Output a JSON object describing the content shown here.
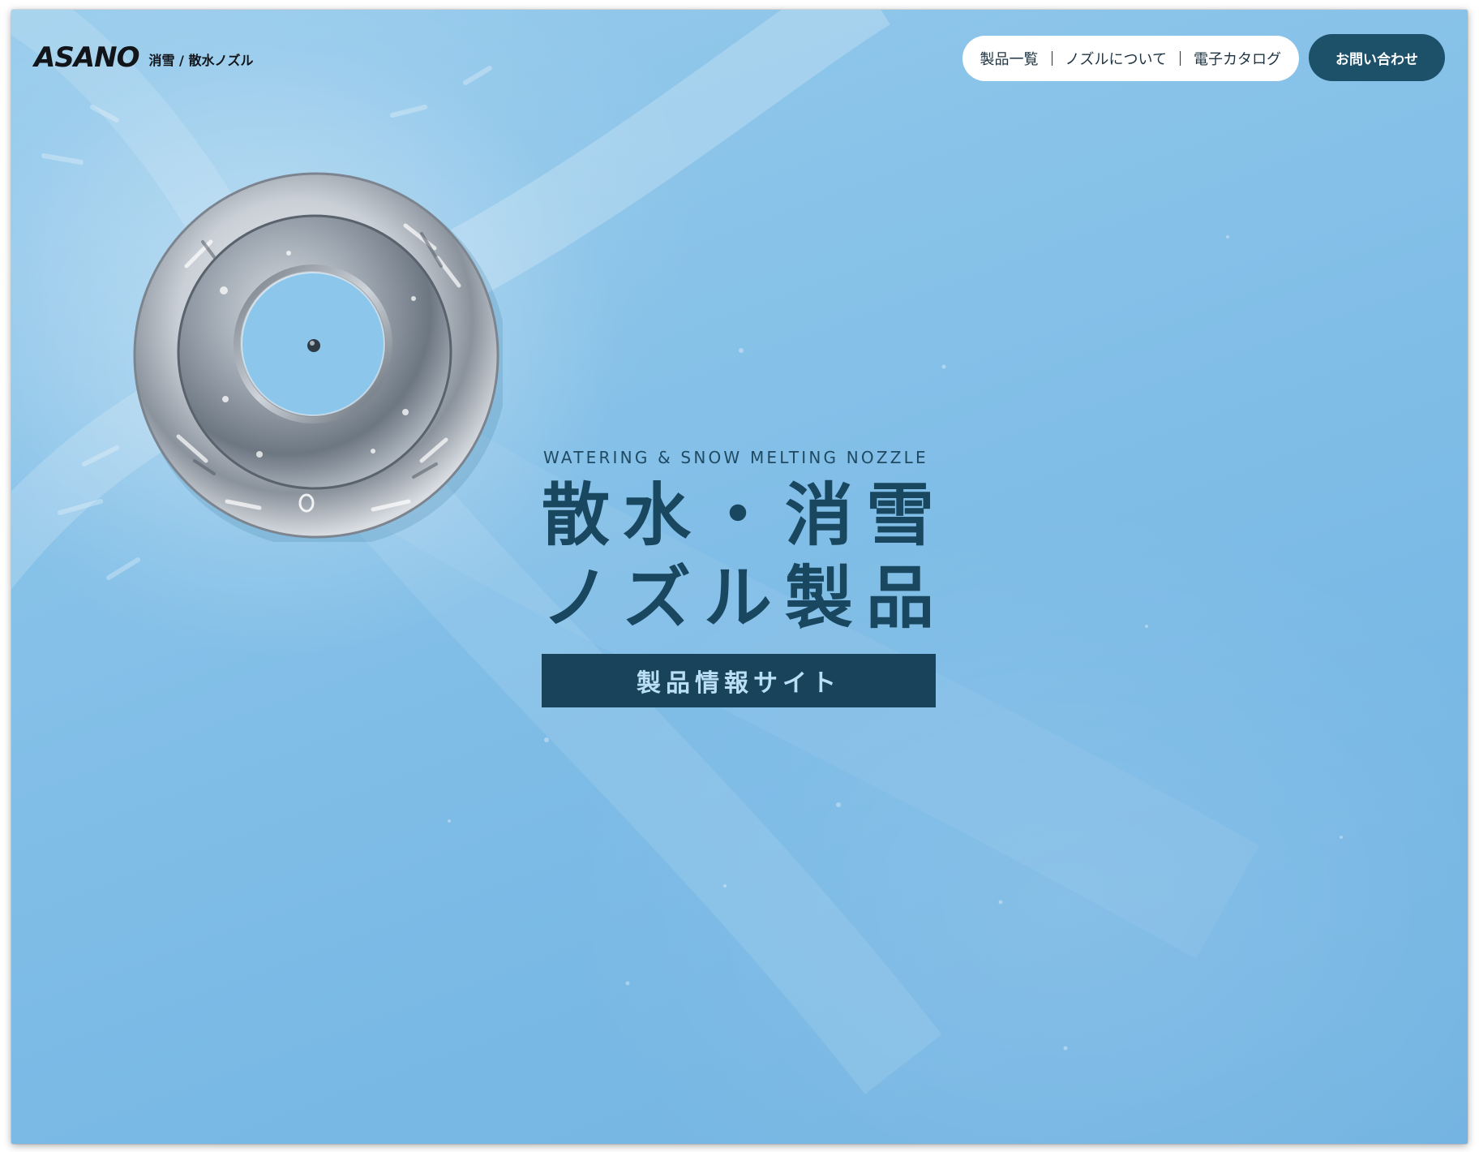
{
  "header": {
    "logo_text": "ASANO",
    "logo_sub": "消雪 / 散水ノズル",
    "nav": [
      {
        "label": "製品一覧"
      },
      {
        "label": "ノズルについて"
      },
      {
        "label": "電子カタログ"
      }
    ],
    "contact_label": "お問い合わせ"
  },
  "hero": {
    "english": "WATERING & SNOW MELTING NOZZLE",
    "title_line1": "散水・消雪",
    "title_line2": "ノズル製品",
    "badge": "製品情報サイト"
  },
  "colors": {
    "background": "#86c1e8",
    "accent_dark": "#1d5069",
    "title": "#1a4760",
    "badge_text": "#b9def5"
  }
}
